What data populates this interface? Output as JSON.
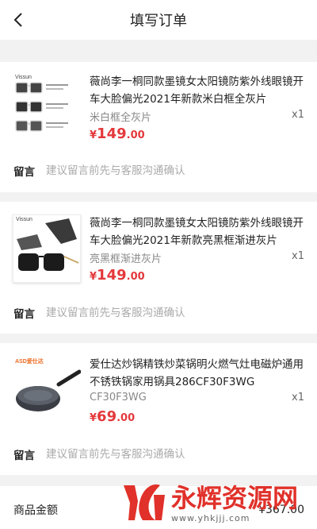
{
  "header": {
    "title": "填写订单",
    "back_icon": "chevron-left-icon"
  },
  "items": [
    {
      "brand": "Vissun",
      "title": "薇尚李一桐同款墨镜女太阳镜防紫外线眼镜开车大脸偏光2021年新款米白框全灰片",
      "variant": "米白框全灰片",
      "qty": "x1",
      "price_symbol": "¥",
      "price_int": "149",
      "price_dec": ".00"
    },
    {
      "brand": "Vissun",
      "title": "薇尚李一桐同款墨镜女太阳镜防紫外线眼镜开车大脸偏光2021年新款亮黑框渐进灰片",
      "variant": "亮黑框渐进灰片",
      "qty": "x1",
      "price_symbol": "¥",
      "price_int": "149",
      "price_dec": ".00"
    },
    {
      "brand": "ASD爱仕达",
      "title": "爱仕达炒锅精铁炒菜锅明火燃气灶电磁炉通用不锈铁锅家用锅具286CF30F3WG",
      "variant": "CF30F3WG",
      "qty": "x1",
      "price_symbol": "¥",
      "price_int": "69",
      "price_dec": ".00"
    }
  ],
  "remark": {
    "label": "留言",
    "placeholder": "建议留言前先与客服沟通确认"
  },
  "summary": {
    "goods_amount_label": "商品金额",
    "goods_amount_value": "¥367.00"
  },
  "watermark": {
    "text": "永辉资源网",
    "url": "www.yhkjjj.com"
  },
  "colors": {
    "price": "#e4393c",
    "background": "#f2f2f2",
    "watermark": "#e0312a"
  }
}
